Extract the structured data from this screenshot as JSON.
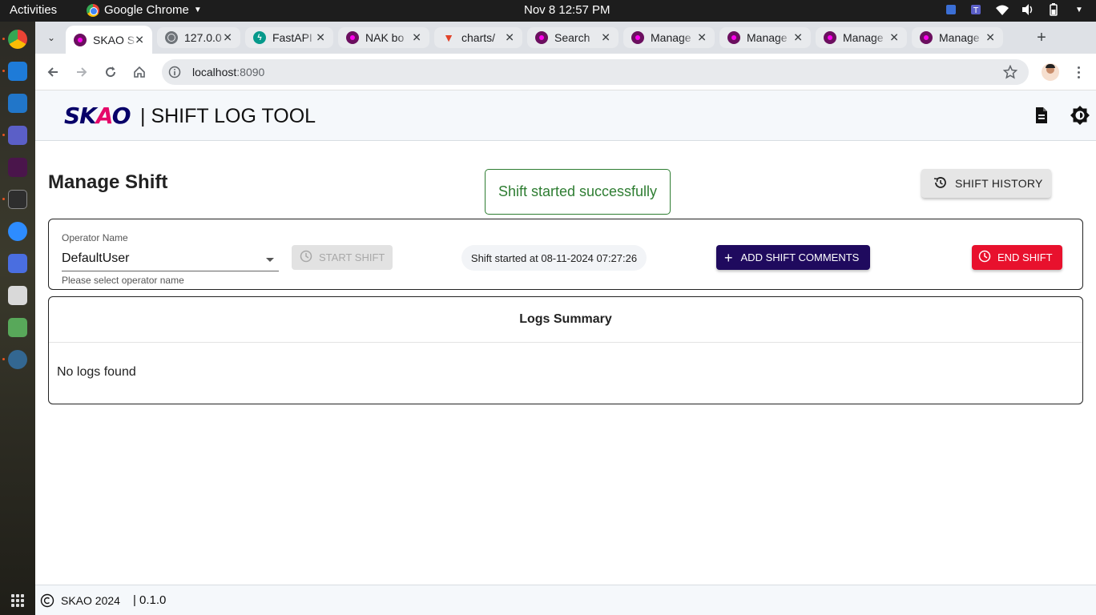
{
  "system": {
    "activities": "Activities",
    "app_name": "Google Chrome",
    "clock": "Nov 8  12:57 PM"
  },
  "browser": {
    "tabs": [
      {
        "label": "SKAO S",
        "favicon": "skao-icon",
        "active": true
      },
      {
        "label": "127.0.0",
        "favicon": "globe-icon",
        "active": false
      },
      {
        "label": "FastAPI",
        "favicon": "fastapi-icon",
        "active": false
      },
      {
        "label": "NAK bo",
        "favicon": "skao-icon",
        "active": false
      },
      {
        "label": "charts/",
        "favicon": "gitlab-icon",
        "active": false
      },
      {
        "label": "Search",
        "favicon": "skao-icon",
        "active": false
      },
      {
        "label": "Manage",
        "favicon": "skao-icon",
        "active": false
      },
      {
        "label": "Manage",
        "favicon": "skao-icon",
        "active": false
      },
      {
        "label": "Manage",
        "favicon": "skao-icon",
        "active": false
      },
      {
        "label": "Manage",
        "favicon": "skao-icon",
        "active": false
      }
    ],
    "url_host": "localhost",
    "url_port": ":8090"
  },
  "app": {
    "logo": "SKAO",
    "title": "| SHIFT LOG TOOL",
    "page_title": "Manage Shift",
    "toast": "Shift started successfully",
    "shift_history_label": "SHIFT HISTORY",
    "operator": {
      "label": "Operator Name",
      "value": "DefaultUser",
      "helper": "Please select operator name"
    },
    "start_shift_label": "START SHIFT",
    "shift_started_text": "Shift started at 08-11-2024 07:27:26",
    "add_comments_label": "ADD SHIFT COMMENTS",
    "end_shift_label": "END SHIFT",
    "logs_summary_title": "Logs Summary",
    "logs_empty": "No logs found",
    "footer_copyright": "SKAO 2024",
    "footer_version": "| 0.1.0"
  },
  "colors": {
    "brand_navy": "#1f0a5e",
    "end_red": "#e8112d",
    "success_green": "#2e7d32"
  }
}
